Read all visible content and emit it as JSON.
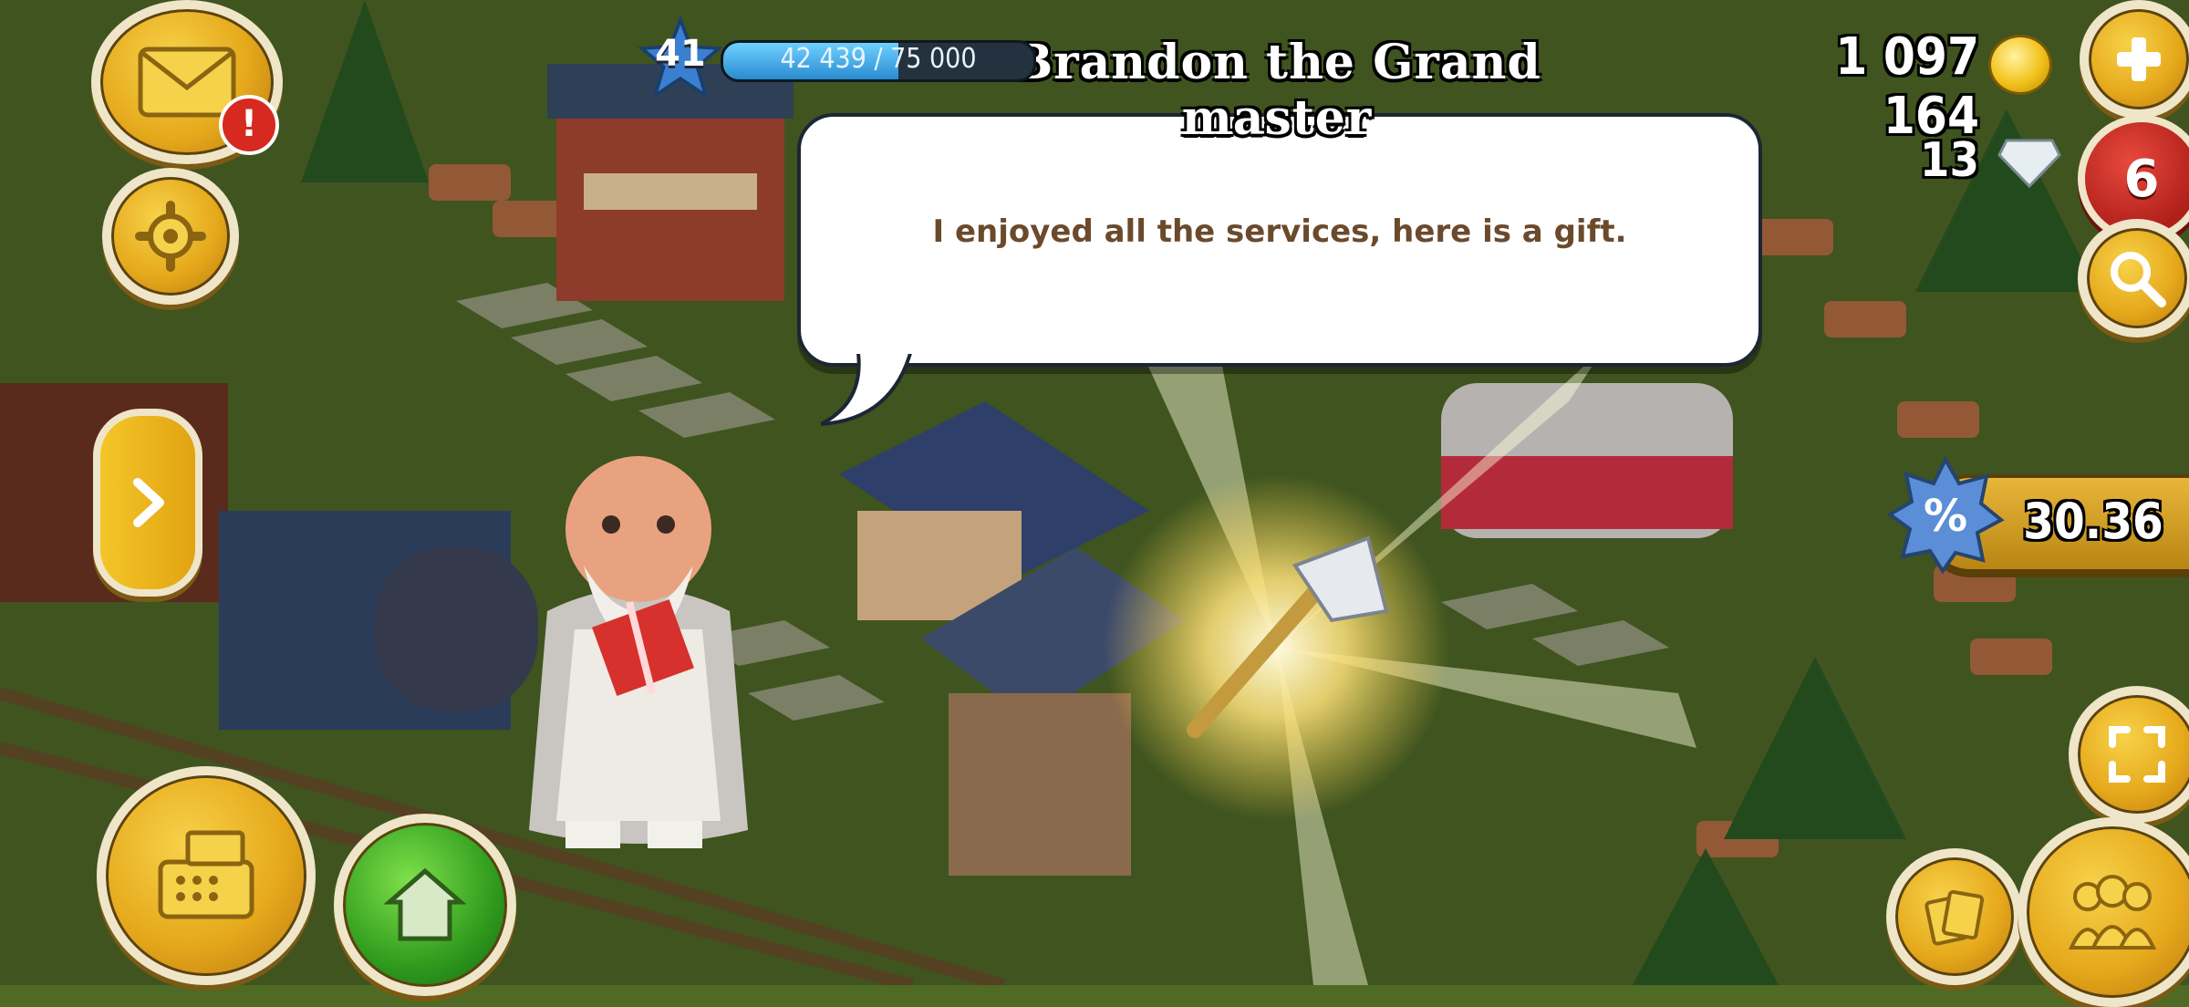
{
  "hud": {
    "level": "41",
    "xp_text": "42 439 / 75 000",
    "xp_progress": 0.566,
    "coins": "1 097 164",
    "gems": "13",
    "notification_count": "6",
    "mail_alert": "!",
    "sale_timer": "30.36"
  },
  "dialog": {
    "speaker": "Brandon the Grand master",
    "message": "I enjoyed all the services, here is a gift."
  },
  "reward": {
    "item": "axe"
  },
  "colors": {
    "accent_gold": "#e6a91c",
    "alert_red": "#d62a20",
    "dialog_text": "#6b4a2c",
    "home_green": "#2f9a1d"
  },
  "icons": [
    "mail-icon",
    "gear-icon",
    "chevron-right-icon",
    "cash-register-icon",
    "home-icon",
    "plus-icon",
    "magnifier-icon",
    "zoom-icon",
    "cards-icon",
    "friends-icon",
    "coin-icon",
    "gem-icon",
    "sale-percent-icon",
    "axe-icon"
  ]
}
